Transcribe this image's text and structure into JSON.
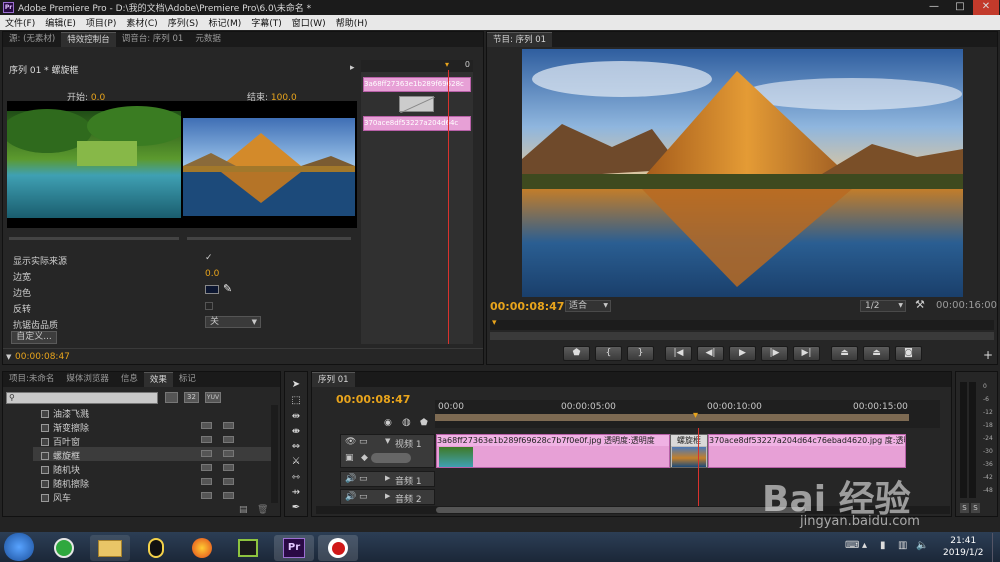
{
  "window": {
    "title": "Adobe Premiere Pro - D:\\我的文档\\Adobe\\Premiere Pro\\6.0\\未命名 *",
    "logo": "Pr",
    "min": "—",
    "max": "□",
    "close": "✕"
  },
  "menu": [
    "文件(F)",
    "编辑(E)",
    "项目(P)",
    "素材(C)",
    "序列(S)",
    "标记(M)",
    "字幕(T)",
    "窗口(W)",
    "帮助(H)"
  ],
  "top_left_tabs": [
    "源: (无素材)",
    "特效控制台",
    "调音台: 序列 01",
    "元数据"
  ],
  "effect_controls": {
    "header": "序列 01 * 螺旋框",
    "start_label": "开始:",
    "start_value": "0.0",
    "end_label": "结束:",
    "end_value": "100.0",
    "show_source": "显示实际来源",
    "border_width_label": "边宽",
    "border_width_value": "0.0",
    "border_color_label": "边色",
    "reverse_label": "反转",
    "antialias_label": "抗锯齿品质",
    "antialias_value": "关",
    "custom_button": "自定义...",
    "timecode": "00:00:08:47",
    "mini_timeline_zero": "0",
    "clip_a_label": "3a68ff27363e1b289f69628c",
    "clip_b_label": "370ace8df53227a204d64c"
  },
  "program": {
    "tab": "节目: 序列 01",
    "timecode": "00:00:08:47",
    "fit": "适合",
    "quality": "1/2",
    "duration": "00:00:16:00"
  },
  "project_tabs": [
    "项目:未命名",
    "媒体浏览器",
    "信息",
    "效果",
    "标记"
  ],
  "effects_list": [
    "油漆飞溅",
    "渐变擦除",
    "百叶窗",
    "螺旋框",
    "随机块",
    "随机擦除",
    "风车"
  ],
  "effects_badges": {
    "a": "32",
    "b": "YUV"
  },
  "timeline": {
    "tab": "序列 01",
    "timecode": "00:00:08:47",
    "ruler": [
      "00:00",
      "00:00:05:00",
      "00:00:10:00",
      "00:00:15:00"
    ],
    "video_track": "视频 1",
    "audio1": "音频 1",
    "audio2": "音频 2",
    "clip1": "3a68ff27363e1b289f69628c7b7f0e0f.jpg",
    "clip1_fx": "透明度:透明度",
    "clip2": "370ace8df53227a204d64c76ebad4620.jpg",
    "clip2_fx": "度:透明度",
    "transition": "螺旋框"
  },
  "meter": {
    "labels": [
      "0",
      "-6",
      "-12",
      "-18",
      "-24",
      "-30",
      "-36",
      "-42",
      "-48",
      "dB"
    ],
    "solo": "S"
  },
  "watermark": {
    "text": "Bai 经验",
    "url": "jingyan.baidu.com"
  },
  "taskbar": {
    "time": "21:41",
    "date": "2019/1/2"
  }
}
